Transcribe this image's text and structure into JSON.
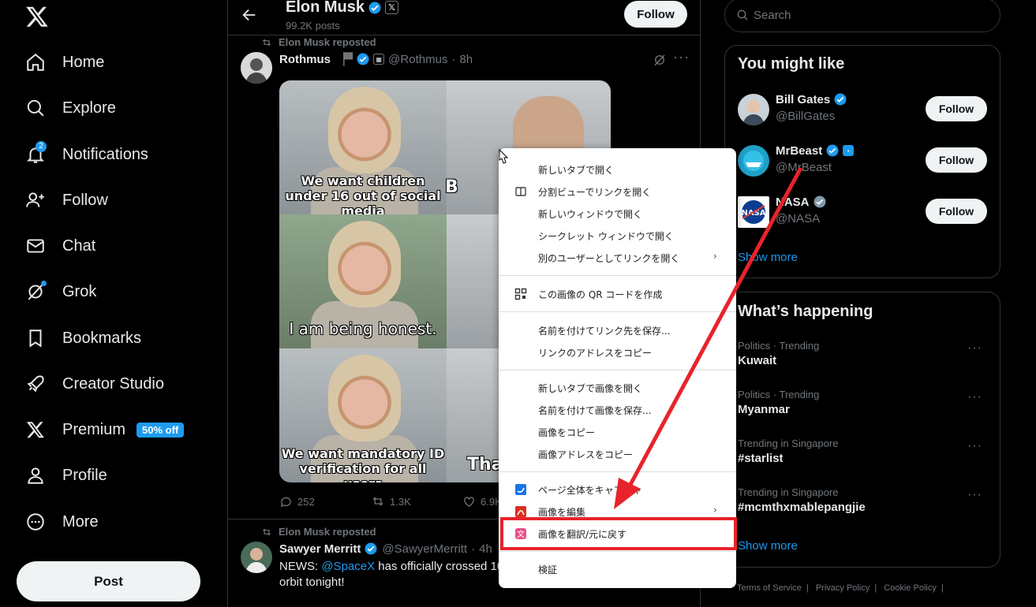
{
  "sidebar": {
    "items": [
      {
        "label": "Home"
      },
      {
        "label": "Explore"
      },
      {
        "label": "Notifications",
        "badge": "2"
      },
      {
        "label": "Follow"
      },
      {
        "label": "Chat"
      },
      {
        "label": "Grok"
      },
      {
        "label": "Bookmarks"
      },
      {
        "label": "Creator Studio"
      },
      {
        "label": "Premium",
        "badge": "50% off"
      },
      {
        "label": "Profile"
      },
      {
        "label": "More"
      }
    ],
    "post_label": "Post"
  },
  "header": {
    "name": "Elon Musk",
    "post_count": "99.2K posts",
    "follow_label": "Follow"
  },
  "tweets": [
    {
      "repost_label": "Elon Musk reposted",
      "name": "Rothmus",
      "handle": "@Rothmus",
      "time": "8h",
      "meme_captions": [
        "We want children under 16 out of social media",
        "I am being honest.",
        "We want mandatory ID verification for all users"
      ],
      "meme_right_text": [
        "B",
        "Tha"
      ],
      "replies": "252",
      "reposts": "1.3K",
      "likes": "6.9K"
    },
    {
      "repost_label": "Elon Musk reposted",
      "name": "Sawyer Merritt",
      "handle": "@SawyerMerritt",
      "time": "4h",
      "text_prefix": "NEWS: ",
      "mention": "@SpaceX",
      "text_rest": " has officially crossed 10",
      "text_line2": "orbit tonight!"
    }
  ],
  "right": {
    "search_placeholder": "Search",
    "you_might_like_title": "You might like",
    "suggestions": [
      {
        "name": "Bill Gates",
        "handle": "@BillGates",
        "follow": "Follow"
      },
      {
        "name": "MrBeast",
        "handle": "@MrBeast",
        "follow": "Follow"
      },
      {
        "name": "NASA",
        "handle": "@NASA",
        "follow": "Follow"
      }
    ],
    "show_more": "Show more",
    "whats_happening_title": "What’s happening",
    "trends": [
      {
        "context": "Politics · Trending",
        "topic": "Kuwait"
      },
      {
        "context": "Politics · Trending",
        "topic": "Myanmar"
      },
      {
        "context": "Trending in Singapore",
        "topic": "#starlist"
      },
      {
        "context": "Trending in Singapore",
        "topic": "#mcmthxmablepangjie"
      }
    ],
    "show_more_2": "Show more",
    "footer": [
      "Terms of Service",
      "|",
      "Privacy Policy",
      "|",
      "Cookie Policy",
      "|"
    ]
  },
  "context_menu": {
    "items": [
      "新しいタブで開く",
      "分割ビューでリンクを開く",
      "新しいウィンドウで開く",
      "シークレット ウィンドウで開く",
      "別のユーザーとしてリンクを開く",
      "この画像の QR コードを作成",
      "名前を付けてリンク先を保存...",
      "リンクのアドレスをコピー",
      "新しいタブで画像を開く",
      "名前を付けて画像を保存...",
      "画像をコピー",
      "画像アドレスをコピー",
      "ページ全体をキャプチャ",
      "画像を編集",
      "画像を翻訳/元に戻す",
      "検証"
    ]
  },
  "colors": {
    "accent": "#1d9bf0",
    "highlight": "#e8232b",
    "background": "#000000",
    "border": "#2f3336"
  }
}
